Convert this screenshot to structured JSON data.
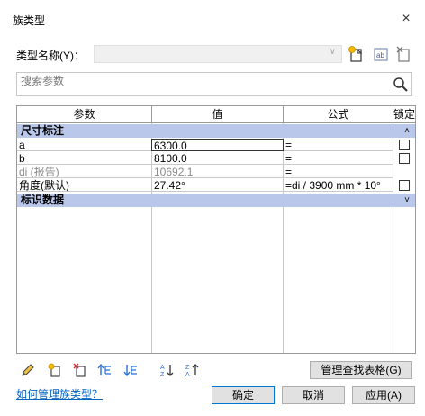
{
  "window": {
    "title": "族类型",
    "close_glyph": "×"
  },
  "type_name": {
    "label": "类型名称(Y)：",
    "value": ""
  },
  "toolbar_icons": [
    "new-type-icon",
    "rename-type-icon",
    "delete-type-icon"
  ],
  "search": {
    "placeholder": "搜索参数"
  },
  "table": {
    "columns": [
      "参数",
      "值",
      "公式",
      "锁定"
    ],
    "groups": [
      {
        "name": "尺寸标注",
        "toggle": "˄",
        "rows": [
          {
            "param": "a",
            "value": "6300.0",
            "formula": "=",
            "locked": false,
            "readonly": false
          },
          {
            "param": "b",
            "value": "8100.0",
            "formula": "=",
            "locked": false,
            "readonly": false
          },
          {
            "param": "di (报告)",
            "value": "10692.1",
            "formula": "=",
            "locked": null,
            "readonly": true
          },
          {
            "param": "角度(默认)",
            "value": "27.42°",
            "formula": "=di / 3900 mm * 10°",
            "locked": false,
            "readonly": false
          }
        ]
      },
      {
        "name": "标识数据",
        "toggle": "˅",
        "rows": []
      }
    ]
  },
  "bottom_toolbar": [
    "edit-pencil-icon",
    "new-parameter-icon",
    "delete-parameter-icon",
    "move-up-icon",
    "move-down-icon",
    "sort-ascending-icon",
    "sort-descending-icon"
  ],
  "buttons": {
    "manage_lookup": "管理查找表格(G)",
    "ok": "确定",
    "cancel": "取消",
    "apply": "应用(A)"
  },
  "help_link": "如何管理族类型？",
  "colors": {
    "group_header": "#b8c7ea",
    "link": "#0563c1",
    "default_button_border": "#0078d7"
  }
}
